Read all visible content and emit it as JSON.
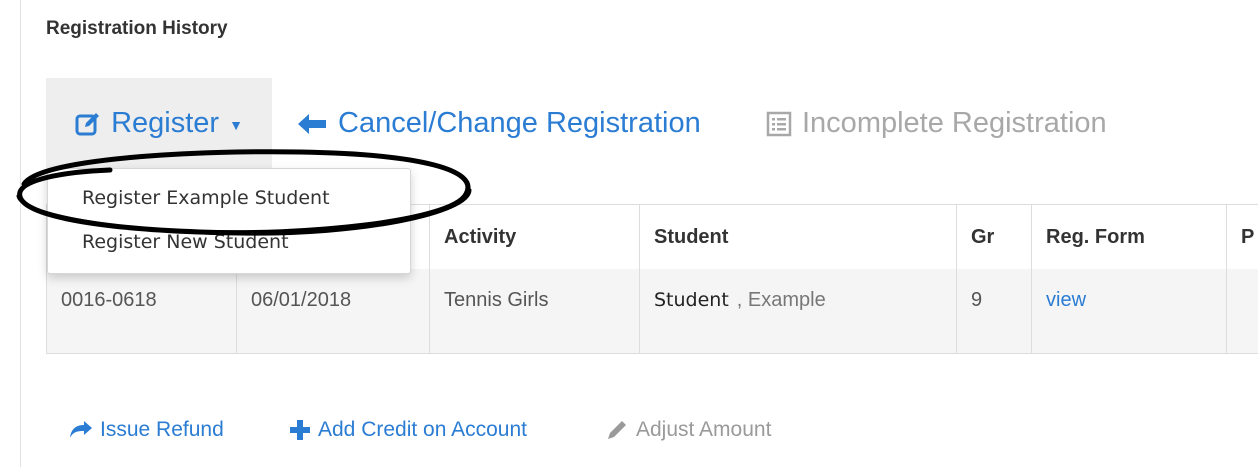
{
  "section_title": "Registration History",
  "nav": {
    "register_label": "Register",
    "cancel_label": "Cancel/Change Registration",
    "incomplete_label": "Incomplete Registration"
  },
  "dropdown": {
    "items": [
      "Register Example Student",
      "Register New Student"
    ]
  },
  "table": {
    "headers": [
      "",
      "",
      "Activity",
      "Student",
      "Gr",
      "Reg. Form",
      "P"
    ],
    "rows": [
      {
        "id": "0016-0618",
        "date": "06/01/2018",
        "activity": "Tennis Girls",
        "student_first": "Student",
        "student_last": ", Example",
        "grade": "9",
        "reg_form": "view"
      }
    ]
  },
  "actions": {
    "refund": "Issue Refund",
    "credit": "Add Credit on Account",
    "adjust": "Adjust Amount"
  },
  "colors": {
    "link": "#2b7cd3",
    "disabled": "#a8a8a8",
    "annotation": "#000000"
  },
  "icons": {
    "register": "edit-icon",
    "cancel": "arrow-left-icon",
    "incomplete": "list-icon",
    "refund": "share-arrow-icon",
    "credit": "plus-icon",
    "adjust": "pencil-icon"
  }
}
